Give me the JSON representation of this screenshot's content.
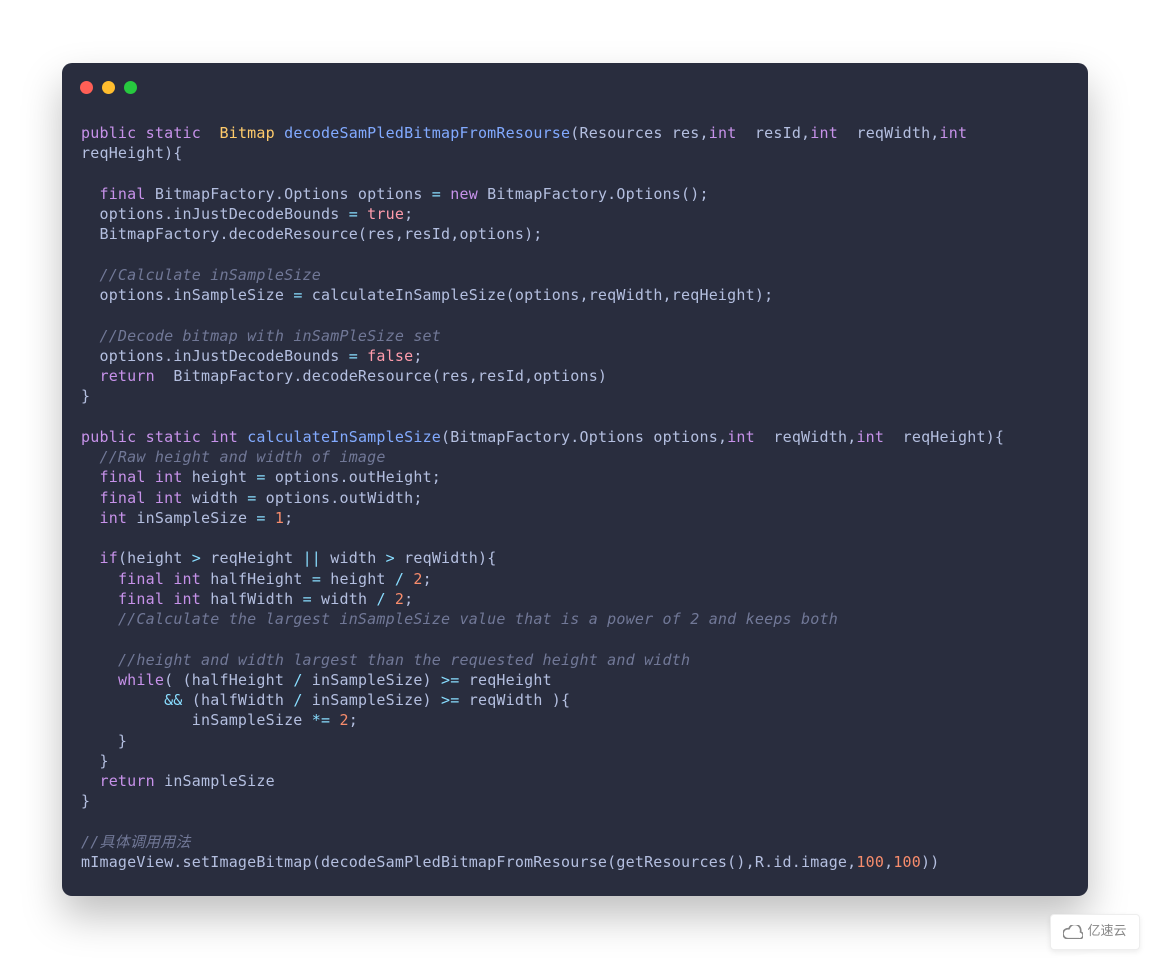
{
  "window": {
    "dots": [
      "red",
      "yellow",
      "green"
    ]
  },
  "tokens": [
    {
      "c": "kw",
      "t": "public"
    },
    {
      "c": "pn",
      "t": " "
    },
    {
      "c": "kw",
      "t": "static"
    },
    {
      "c": "pn",
      "t": "  "
    },
    {
      "c": "ty",
      "t": "Bitmap"
    },
    {
      "c": "pn",
      "t": " "
    },
    {
      "c": "fn",
      "t": "decodeSamPledBitmapFromResourse"
    },
    {
      "c": "pn",
      "t": "(Resources res,"
    },
    {
      "c": "kw",
      "t": "int"
    },
    {
      "c": "pn",
      "t": "  resId,"
    },
    {
      "c": "kw",
      "t": "int"
    },
    {
      "c": "pn",
      "t": "  reqWidth,"
    },
    {
      "c": "kw",
      "t": "int"
    },
    {
      "c": "pn",
      "t": "  \nreqHeight){\n\n"
    },
    {
      "c": "pn",
      "t": "  "
    },
    {
      "c": "kw",
      "t": "final"
    },
    {
      "c": "pn",
      "t": " BitmapFactory.Options options "
    },
    {
      "c": "op",
      "t": "="
    },
    {
      "c": "pn",
      "t": " "
    },
    {
      "c": "kw",
      "t": "new"
    },
    {
      "c": "pn",
      "t": " BitmapFactory.Options();\n"
    },
    {
      "c": "pn",
      "t": "  options.inJustDecodeBounds "
    },
    {
      "c": "op",
      "t": "="
    },
    {
      "c": "pn",
      "t": " "
    },
    {
      "c": "bo",
      "t": "true"
    },
    {
      "c": "pn",
      "t": ";\n"
    },
    {
      "c": "pn",
      "t": "  BitmapFactory.decodeResource(res,resId,options);\n\n"
    },
    {
      "c": "pn",
      "t": "  "
    },
    {
      "c": "cm",
      "t": "//Calculate inSampleSize"
    },
    {
      "c": "pn",
      "t": "\n"
    },
    {
      "c": "pn",
      "t": "  options.inSampleSize "
    },
    {
      "c": "op",
      "t": "="
    },
    {
      "c": "pn",
      "t": " calculateInSampleSize(options,reqWidth,reqHeight);\n\n"
    },
    {
      "c": "pn",
      "t": "  "
    },
    {
      "c": "cm",
      "t": "//Decode bitmap with inSamPleSize set"
    },
    {
      "c": "pn",
      "t": "\n"
    },
    {
      "c": "pn",
      "t": "  options.inJustDecodeBounds "
    },
    {
      "c": "op",
      "t": "="
    },
    {
      "c": "pn",
      "t": " "
    },
    {
      "c": "bo",
      "t": "false"
    },
    {
      "c": "pn",
      "t": ";\n"
    },
    {
      "c": "pn",
      "t": "  "
    },
    {
      "c": "kw",
      "t": "return"
    },
    {
      "c": "pn",
      "t": "  BitmapFactory.decodeResource(res,resId,options)\n}\n\n"
    },
    {
      "c": "kw",
      "t": "public"
    },
    {
      "c": "pn",
      "t": " "
    },
    {
      "c": "kw",
      "t": "static"
    },
    {
      "c": "pn",
      "t": " "
    },
    {
      "c": "kw",
      "t": "int"
    },
    {
      "c": "pn",
      "t": " "
    },
    {
      "c": "fn",
      "t": "calculateInSampleSize"
    },
    {
      "c": "pn",
      "t": "(BitmapFactory.Options options,"
    },
    {
      "c": "kw",
      "t": "int"
    },
    {
      "c": "pn",
      "t": "  reqWidth,"
    },
    {
      "c": "kw",
      "t": "int"
    },
    {
      "c": "pn",
      "t": "  reqHeight){\n"
    },
    {
      "c": "pn",
      "t": "  "
    },
    {
      "c": "cm",
      "t": "//Raw height and width of image"
    },
    {
      "c": "pn",
      "t": "\n"
    },
    {
      "c": "pn",
      "t": "  "
    },
    {
      "c": "kw",
      "t": "final"
    },
    {
      "c": "pn",
      "t": " "
    },
    {
      "c": "kw",
      "t": "int"
    },
    {
      "c": "pn",
      "t": " height "
    },
    {
      "c": "op",
      "t": "="
    },
    {
      "c": "pn",
      "t": " options.outHeight;\n"
    },
    {
      "c": "pn",
      "t": "  "
    },
    {
      "c": "kw",
      "t": "final"
    },
    {
      "c": "pn",
      "t": " "
    },
    {
      "c": "kw",
      "t": "int"
    },
    {
      "c": "pn",
      "t": " width "
    },
    {
      "c": "op",
      "t": "="
    },
    {
      "c": "pn",
      "t": " options.outWidth;\n"
    },
    {
      "c": "pn",
      "t": "  "
    },
    {
      "c": "kw",
      "t": "int"
    },
    {
      "c": "pn",
      "t": " inSampleSize "
    },
    {
      "c": "op",
      "t": "="
    },
    {
      "c": "pn",
      "t": " "
    },
    {
      "c": "nm",
      "t": "1"
    },
    {
      "c": "pn",
      "t": ";\n\n"
    },
    {
      "c": "pn",
      "t": "  "
    },
    {
      "c": "kw",
      "t": "if"
    },
    {
      "c": "pn",
      "t": "(height "
    },
    {
      "c": "op",
      "t": ">"
    },
    {
      "c": "pn",
      "t": " reqHeight "
    },
    {
      "c": "op",
      "t": "||"
    },
    {
      "c": "pn",
      "t": " width "
    },
    {
      "c": "op",
      "t": ">"
    },
    {
      "c": "pn",
      "t": " reqWidth){\n"
    },
    {
      "c": "pn",
      "t": "    "
    },
    {
      "c": "kw",
      "t": "final"
    },
    {
      "c": "pn",
      "t": " "
    },
    {
      "c": "kw",
      "t": "int"
    },
    {
      "c": "pn",
      "t": " halfHeight "
    },
    {
      "c": "op",
      "t": "="
    },
    {
      "c": "pn",
      "t": " height "
    },
    {
      "c": "op",
      "t": "/"
    },
    {
      "c": "pn",
      "t": " "
    },
    {
      "c": "nm",
      "t": "2"
    },
    {
      "c": "pn",
      "t": ";\n"
    },
    {
      "c": "pn",
      "t": "    "
    },
    {
      "c": "kw",
      "t": "final"
    },
    {
      "c": "pn",
      "t": " "
    },
    {
      "c": "kw",
      "t": "int"
    },
    {
      "c": "pn",
      "t": " halfWidth "
    },
    {
      "c": "op",
      "t": "="
    },
    {
      "c": "pn",
      "t": " width "
    },
    {
      "c": "op",
      "t": "/"
    },
    {
      "c": "pn",
      "t": " "
    },
    {
      "c": "nm",
      "t": "2"
    },
    {
      "c": "pn",
      "t": ";\n"
    },
    {
      "c": "pn",
      "t": "    "
    },
    {
      "c": "cm",
      "t": "//Calculate the largest inSampleSize value that is a power of 2 and keeps both"
    },
    {
      "c": "pn",
      "t": "\n\n"
    },
    {
      "c": "pn",
      "t": "    "
    },
    {
      "c": "cm",
      "t": "//height and width largest than the requested height and width"
    },
    {
      "c": "pn",
      "t": "\n"
    },
    {
      "c": "pn",
      "t": "    "
    },
    {
      "c": "kw",
      "t": "while"
    },
    {
      "c": "pn",
      "t": "( (halfHeight "
    },
    {
      "c": "op",
      "t": "/"
    },
    {
      "c": "pn",
      "t": " inSampleSize) "
    },
    {
      "c": "op",
      "t": ">="
    },
    {
      "c": "pn",
      "t": " reqHeight\n"
    },
    {
      "c": "pn",
      "t": "         "
    },
    {
      "c": "op",
      "t": "&&"
    },
    {
      "c": "pn",
      "t": " (halfWidth "
    },
    {
      "c": "op",
      "t": "/"
    },
    {
      "c": "pn",
      "t": " inSampleSize) "
    },
    {
      "c": "op",
      "t": ">="
    },
    {
      "c": "pn",
      "t": " reqWidth ){\n"
    },
    {
      "c": "pn",
      "t": "            inSampleSize "
    },
    {
      "c": "op",
      "t": "*="
    },
    {
      "c": "pn",
      "t": " "
    },
    {
      "c": "nm",
      "t": "2"
    },
    {
      "c": "pn",
      "t": ";\n"
    },
    {
      "c": "pn",
      "t": "    }\n"
    },
    {
      "c": "pn",
      "t": "  }\n"
    },
    {
      "c": "pn",
      "t": "  "
    },
    {
      "c": "kw",
      "t": "return"
    },
    {
      "c": "pn",
      "t": " inSampleSize\n}\n\n"
    },
    {
      "c": "cm",
      "t": "//具体调用用法"
    },
    {
      "c": "pn",
      "t": "\n"
    },
    {
      "c": "pn",
      "t": "mImageView.setImageBitmap(decodeSamPledBitmapFromResourse(getResources(),R.id.image,"
    },
    {
      "c": "nm",
      "t": "100"
    },
    {
      "c": "pn",
      "t": ","
    },
    {
      "c": "nm",
      "t": "100"
    },
    {
      "c": "pn",
      "t": "))"
    }
  ],
  "watermark": {
    "label": "亿速云"
  }
}
